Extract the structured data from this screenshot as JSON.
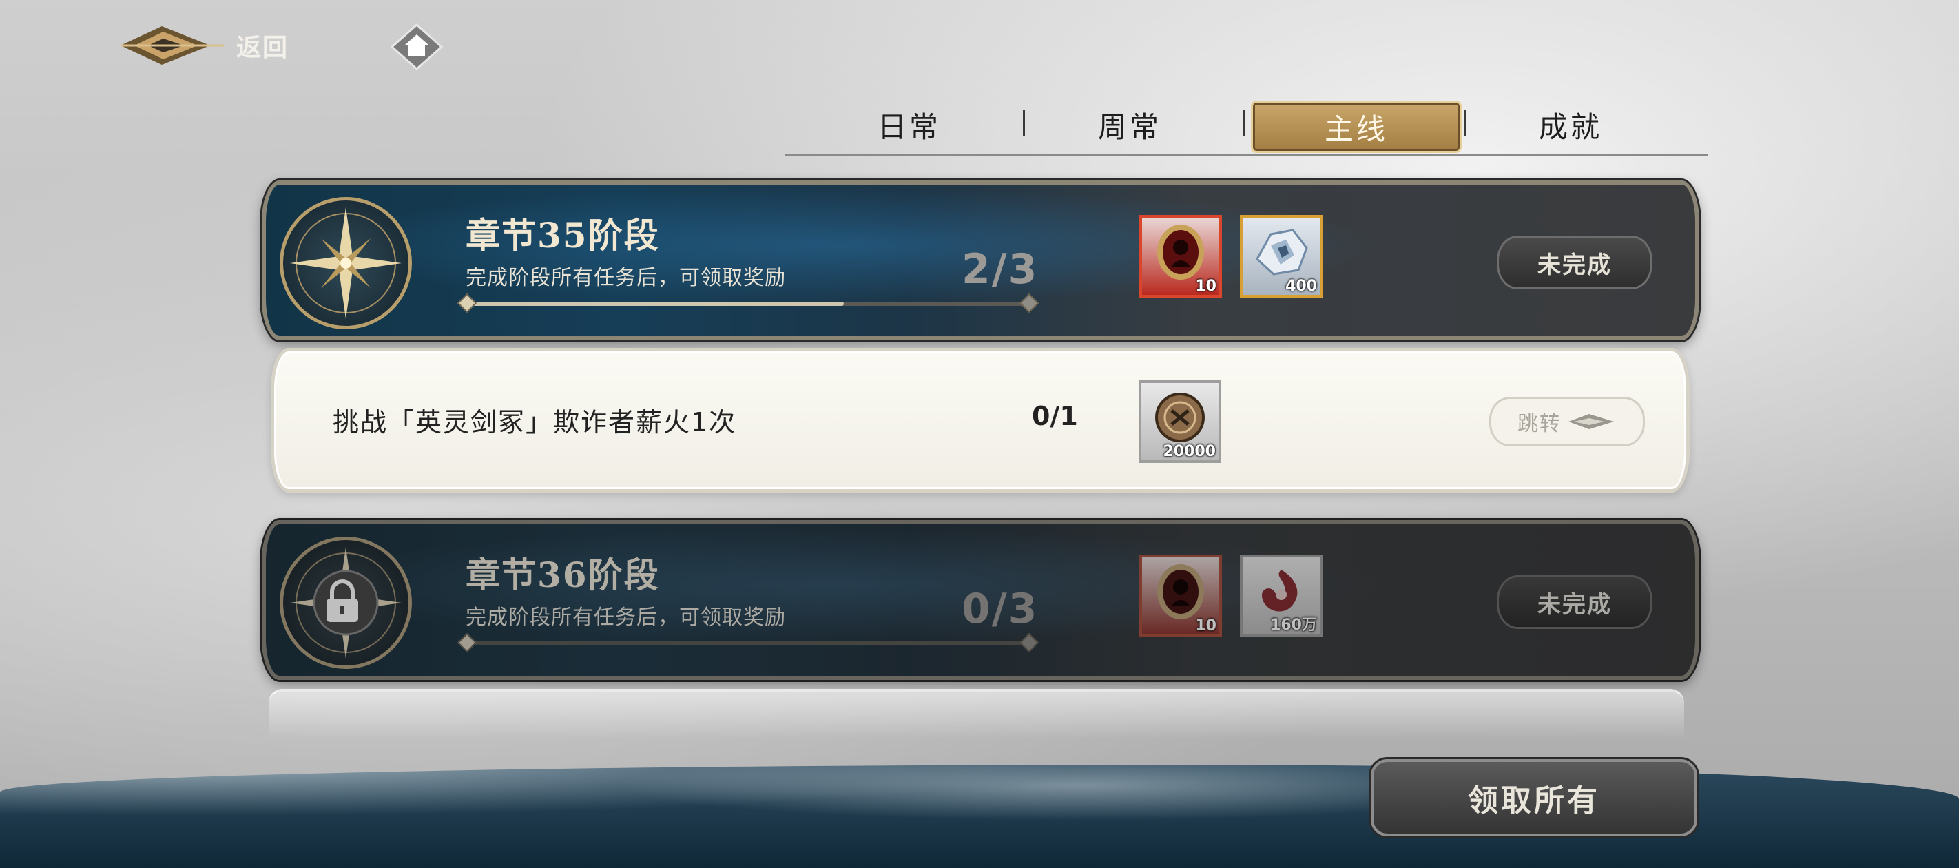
{
  "header": {
    "back_label": "返回"
  },
  "tabs": [
    {
      "label": "日常",
      "active": false
    },
    {
      "label": "周常",
      "active": false
    },
    {
      "label": "主线",
      "active": true
    },
    {
      "label": "成就",
      "active": false
    }
  ],
  "chapters": [
    {
      "title": "章节35阶段",
      "subtitle": "完成阶段所有任务后，可领取奖励",
      "progress": "2/3",
      "progress_fraction": 0.67,
      "locked": false,
      "status": "未完成",
      "rewards": [
        {
          "icon": "red-medallion-icon",
          "quantity": "10",
          "frame_color": "#d9462c"
        },
        {
          "icon": "crystal-ore-icon",
          "quantity": "400",
          "frame_color": "#d8a032"
        }
      ]
    },
    {
      "title": "章节36阶段",
      "subtitle": "完成阶段所有任务后，可领取奖励",
      "progress": "0/3",
      "progress_fraction": 0,
      "locked": true,
      "status": "未完成",
      "rewards": [
        {
          "icon": "red-medallion-icon",
          "quantity": "10",
          "frame_color": "#d9462c"
        },
        {
          "icon": "crimson-essence-icon",
          "quantity": "160万",
          "frame_color": "#9e9e9e"
        }
      ]
    }
  ],
  "task": {
    "description": "挑战「英灵剑冢」欺诈者薪火1次",
    "progress": "0/1",
    "reward": {
      "icon": "bronze-coin-icon",
      "quantity": "20000"
    },
    "action": "跳转"
  },
  "footer": {
    "claim_all_label": "领取所有"
  },
  "colors": {
    "accent_gold": "#c9a66a",
    "card_dark": "#163e57",
    "card_light": "#f5f3ec"
  }
}
